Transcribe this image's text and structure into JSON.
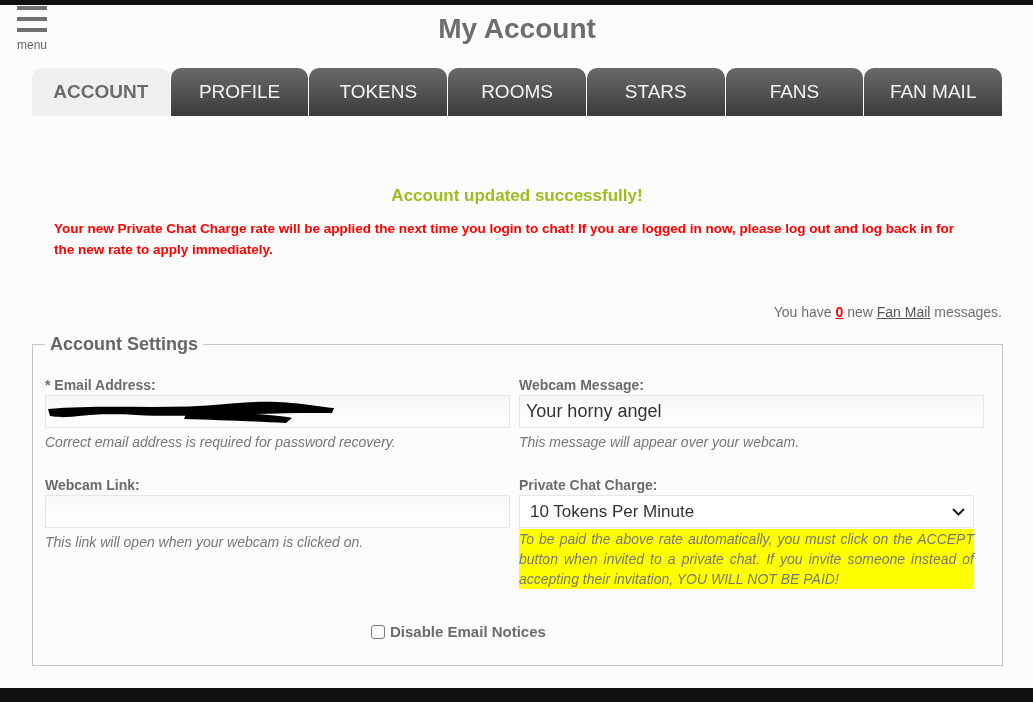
{
  "header": {
    "menu_label": "menu",
    "title": "My Account"
  },
  "tabs": [
    {
      "label": "ACCOUNT",
      "selected": true
    },
    {
      "label": "PROFILE",
      "selected": false
    },
    {
      "label": "TOKENS",
      "selected": false
    },
    {
      "label": "ROOMS",
      "selected": false
    },
    {
      "label": "STARS",
      "selected": false
    },
    {
      "label": "FANS",
      "selected": false
    },
    {
      "label": "FAN MAIL",
      "selected": false
    }
  ],
  "messages": {
    "success": "Account updated successfully!",
    "warning": "Your new Private Chat Charge rate will be applied the next time you login to chat! If you are logged in now, please log out and log back in for the new rate to apply immediately."
  },
  "fan_mail_notice": {
    "prefix": "You have",
    "count": "0",
    "middle": "new",
    "link": "Fan Mail",
    "suffix": "messages."
  },
  "account_settings": {
    "legend": "Account Settings",
    "fields": [
      {
        "kind": "text",
        "label": "* Email Address:",
        "redacted": true,
        "hint": "Correct email address is required for password recovery.",
        "highlight": false
      },
      {
        "kind": "text",
        "label": "Webcam Message:",
        "value": "Your horny angel",
        "redacted": false,
        "hint": "This message will appear over your webcam.",
        "highlight": false
      },
      {
        "kind": "text",
        "label": "Webcam Link:",
        "redacted": false,
        "hint": "This link will open when your webcam is clicked on.",
        "highlight": false
      },
      {
        "kind": "select",
        "label": "Private Chat Charge:",
        "value": "10 Tokens Per Minute",
        "hint": "To be paid the above rate automatically, you must click on the ACCEPT button when invited to a private chat. If you invite someone instead of accepting their invitation, YOU WILL NOT BE PAID!",
        "highlight": true
      }
    ],
    "checkboxes": [
      {
        "label": "Disable Email Notices",
        "checked": false
      }
    ]
  }
}
